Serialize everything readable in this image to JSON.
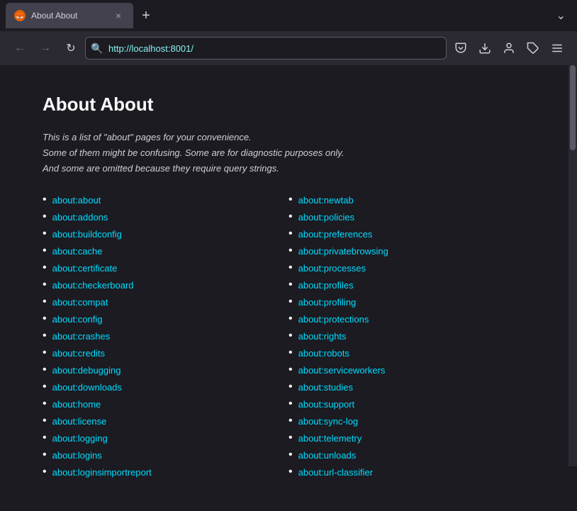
{
  "browser": {
    "tab": {
      "favicon": "🦊",
      "title": "About About",
      "close_label": "×"
    },
    "new_tab_label": "+",
    "tab_overflow_label": "⌄",
    "nav": {
      "back_label": "←",
      "forward_label": "→",
      "reload_label": "↻",
      "search_icon": "🔍",
      "url": "http://localhost:8001/"
    },
    "toolbar": {
      "pocket_icon": "⊘",
      "download_icon": "⬇",
      "account_icon": "👤",
      "extension_icon": "🔧",
      "menu_icon": "☰"
    }
  },
  "page": {
    "title": "About About",
    "description_line1": "This is a list of \"about\" pages for your convenience.",
    "description_line2": "Some of them might be confusing. Some are for diagnostic purposes only.",
    "description_line3": "And some are omitted because they require query strings.",
    "left_links": [
      {
        "text": "about:about",
        "href": "about:about"
      },
      {
        "text": "about:addons",
        "href": "about:addons"
      },
      {
        "text": "about:buildconfig",
        "href": "about:buildconfig"
      },
      {
        "text": "about:cache",
        "href": "about:cache"
      },
      {
        "text": "about:certificate",
        "href": "about:certificate"
      },
      {
        "text": "about:checkerboard",
        "href": "about:checkerboard"
      },
      {
        "text": "about:compat",
        "href": "about:compat"
      },
      {
        "text": "about:config",
        "href": "about:config"
      },
      {
        "text": "about:crashes",
        "href": "about:crashes"
      },
      {
        "text": "about:credits",
        "href": "about:credits"
      },
      {
        "text": "about:debugging",
        "href": "about:debugging"
      },
      {
        "text": "about:downloads",
        "href": "about:downloads"
      },
      {
        "text": "about:home",
        "href": "about:home"
      },
      {
        "text": "about:license",
        "href": "about:license"
      },
      {
        "text": "about:logging",
        "href": "about:logging"
      },
      {
        "text": "about:logins",
        "href": "about:logins"
      },
      {
        "text": "about:loginsimportreport",
        "href": "about:loginsimportreport"
      }
    ],
    "right_links": [
      {
        "text": "about:newtab",
        "href": "about:newtab"
      },
      {
        "text": "about:policies",
        "href": "about:policies"
      },
      {
        "text": "about:preferences",
        "href": "about:preferences"
      },
      {
        "text": "about:privatebrowsing",
        "href": "about:privatebrowsing"
      },
      {
        "text": "about:processes",
        "href": "about:processes"
      },
      {
        "text": "about:profiles",
        "href": "about:profiles"
      },
      {
        "text": "about:profiling",
        "href": "about:profiling"
      },
      {
        "text": "about:protections",
        "href": "about:protections"
      },
      {
        "text": "about:rights",
        "href": "about:rights"
      },
      {
        "text": "about:robots",
        "href": "about:robots"
      },
      {
        "text": "about:serviceworkers",
        "href": "about:serviceworkers"
      },
      {
        "text": "about:studies",
        "href": "about:studies"
      },
      {
        "text": "about:support",
        "href": "about:support"
      },
      {
        "text": "about:sync-log",
        "href": "about:sync-log"
      },
      {
        "text": "about:telemetry",
        "href": "about:telemetry"
      },
      {
        "text": "about:unloads",
        "href": "about:unloads"
      },
      {
        "text": "about:url-classifier",
        "href": "about:url-classifier"
      }
    ]
  }
}
